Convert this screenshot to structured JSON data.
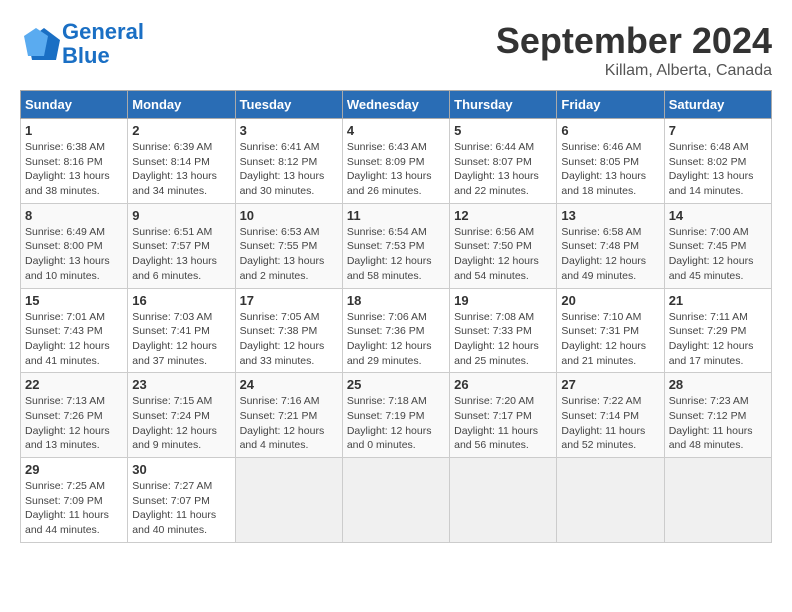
{
  "header": {
    "logo_line1": "General",
    "logo_line2": "Blue",
    "title": "September 2024",
    "subtitle": "Killam, Alberta, Canada"
  },
  "days_of_week": [
    "Sunday",
    "Monday",
    "Tuesday",
    "Wednesday",
    "Thursday",
    "Friday",
    "Saturday"
  ],
  "weeks": [
    [
      {
        "day": "1",
        "info": "Sunrise: 6:38 AM\nSunset: 8:16 PM\nDaylight: 13 hours\nand 38 minutes."
      },
      {
        "day": "2",
        "info": "Sunrise: 6:39 AM\nSunset: 8:14 PM\nDaylight: 13 hours\nand 34 minutes."
      },
      {
        "day": "3",
        "info": "Sunrise: 6:41 AM\nSunset: 8:12 PM\nDaylight: 13 hours\nand 30 minutes."
      },
      {
        "day": "4",
        "info": "Sunrise: 6:43 AM\nSunset: 8:09 PM\nDaylight: 13 hours\nand 26 minutes."
      },
      {
        "day": "5",
        "info": "Sunrise: 6:44 AM\nSunset: 8:07 PM\nDaylight: 13 hours\nand 22 minutes."
      },
      {
        "day": "6",
        "info": "Sunrise: 6:46 AM\nSunset: 8:05 PM\nDaylight: 13 hours\nand 18 minutes."
      },
      {
        "day": "7",
        "info": "Sunrise: 6:48 AM\nSunset: 8:02 PM\nDaylight: 13 hours\nand 14 minutes."
      }
    ],
    [
      {
        "day": "8",
        "info": "Sunrise: 6:49 AM\nSunset: 8:00 PM\nDaylight: 13 hours\nand 10 minutes."
      },
      {
        "day": "9",
        "info": "Sunrise: 6:51 AM\nSunset: 7:57 PM\nDaylight: 13 hours\nand 6 minutes."
      },
      {
        "day": "10",
        "info": "Sunrise: 6:53 AM\nSunset: 7:55 PM\nDaylight: 13 hours\nand 2 minutes."
      },
      {
        "day": "11",
        "info": "Sunrise: 6:54 AM\nSunset: 7:53 PM\nDaylight: 12 hours\nand 58 minutes."
      },
      {
        "day": "12",
        "info": "Sunrise: 6:56 AM\nSunset: 7:50 PM\nDaylight: 12 hours\nand 54 minutes."
      },
      {
        "day": "13",
        "info": "Sunrise: 6:58 AM\nSunset: 7:48 PM\nDaylight: 12 hours\nand 49 minutes."
      },
      {
        "day": "14",
        "info": "Sunrise: 7:00 AM\nSunset: 7:45 PM\nDaylight: 12 hours\nand 45 minutes."
      }
    ],
    [
      {
        "day": "15",
        "info": "Sunrise: 7:01 AM\nSunset: 7:43 PM\nDaylight: 12 hours\nand 41 minutes."
      },
      {
        "day": "16",
        "info": "Sunrise: 7:03 AM\nSunset: 7:41 PM\nDaylight: 12 hours\nand 37 minutes."
      },
      {
        "day": "17",
        "info": "Sunrise: 7:05 AM\nSunset: 7:38 PM\nDaylight: 12 hours\nand 33 minutes."
      },
      {
        "day": "18",
        "info": "Sunrise: 7:06 AM\nSunset: 7:36 PM\nDaylight: 12 hours\nand 29 minutes."
      },
      {
        "day": "19",
        "info": "Sunrise: 7:08 AM\nSunset: 7:33 PM\nDaylight: 12 hours\nand 25 minutes."
      },
      {
        "day": "20",
        "info": "Sunrise: 7:10 AM\nSunset: 7:31 PM\nDaylight: 12 hours\nand 21 minutes."
      },
      {
        "day": "21",
        "info": "Sunrise: 7:11 AM\nSunset: 7:29 PM\nDaylight: 12 hours\nand 17 minutes."
      }
    ],
    [
      {
        "day": "22",
        "info": "Sunrise: 7:13 AM\nSunset: 7:26 PM\nDaylight: 12 hours\nand 13 minutes."
      },
      {
        "day": "23",
        "info": "Sunrise: 7:15 AM\nSunset: 7:24 PM\nDaylight: 12 hours\nand 9 minutes."
      },
      {
        "day": "24",
        "info": "Sunrise: 7:16 AM\nSunset: 7:21 PM\nDaylight: 12 hours\nand 4 minutes."
      },
      {
        "day": "25",
        "info": "Sunrise: 7:18 AM\nSunset: 7:19 PM\nDaylight: 12 hours\nand 0 minutes."
      },
      {
        "day": "26",
        "info": "Sunrise: 7:20 AM\nSunset: 7:17 PM\nDaylight: 11 hours\nand 56 minutes."
      },
      {
        "day": "27",
        "info": "Sunrise: 7:22 AM\nSunset: 7:14 PM\nDaylight: 11 hours\nand 52 minutes."
      },
      {
        "day": "28",
        "info": "Sunrise: 7:23 AM\nSunset: 7:12 PM\nDaylight: 11 hours\nand 48 minutes."
      }
    ],
    [
      {
        "day": "29",
        "info": "Sunrise: 7:25 AM\nSunset: 7:09 PM\nDaylight: 11 hours\nand 44 minutes."
      },
      {
        "day": "30",
        "info": "Sunrise: 7:27 AM\nSunset: 7:07 PM\nDaylight: 11 hours\nand 40 minutes."
      },
      {
        "day": "",
        "info": ""
      },
      {
        "day": "",
        "info": ""
      },
      {
        "day": "",
        "info": ""
      },
      {
        "day": "",
        "info": ""
      },
      {
        "day": "",
        "info": ""
      }
    ]
  ]
}
